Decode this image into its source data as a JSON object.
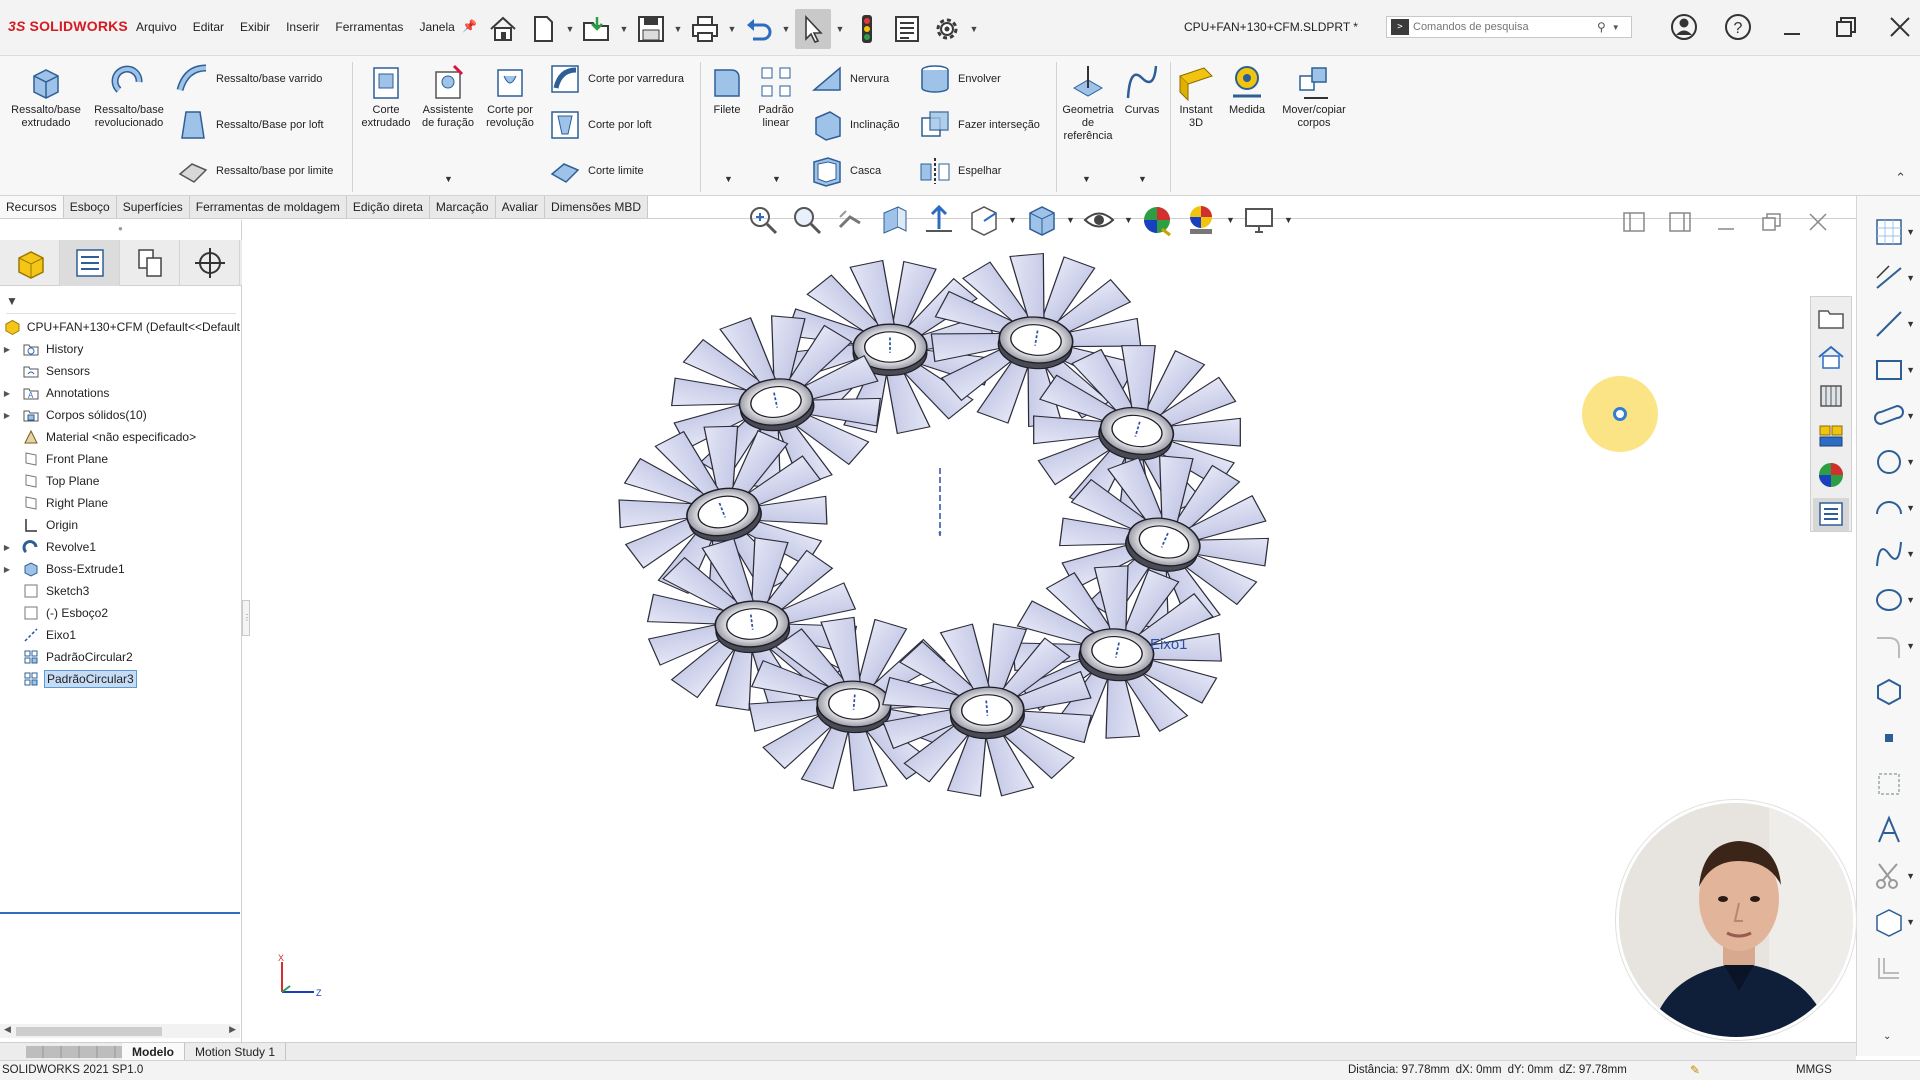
{
  "app": {
    "logo_prefix": "3S",
    "logo_text": "SOLIDWORKS",
    "document_title": "CPU+FAN+130+CFM.SLDPRT *"
  },
  "menubar": [
    "Arquivo",
    "Editar",
    "Exibir",
    "Inserir",
    "Ferramentas",
    "Janela"
  ],
  "search": {
    "placeholder": "Comandos de pesquisa"
  },
  "ribbon": {
    "extruded_boss": "Ressalto/base extrudado",
    "revolved_boss": "Ressalto/base revolucionado",
    "swept_boss": "Ressalto/base varrido",
    "loft_boss": "Ressalto/Base por loft",
    "boundary_boss": "Ressalto/base por limite",
    "extruded_cut": "Corte extrudado",
    "hole_wizard": "Assistente de furação",
    "revolved_cut": "Corte por revolução",
    "swept_cut": "Corte por varredura",
    "lofted_cut": "Corte por loft",
    "boundary_cut": "Corte limite",
    "fillet": "Filete",
    "linear_pattern": "Padrão linear",
    "rib": "Nervura",
    "draft": "Inclinação",
    "shell": "Casca",
    "wrap": "Envolver",
    "intersect": "Fazer interseção",
    "mirror": "Espelhar",
    "ref_geometry": "Geometria de referência",
    "curves": "Curvas",
    "instant3d": "Instant 3D",
    "measure": "Medida",
    "move_copy": "Mover/copiar corpos"
  },
  "tabs": [
    "Recursos",
    "Esboço",
    "Superfícies",
    "Ferramentas de moldagem",
    "Edição direta",
    "Marcação",
    "Avaliar",
    "Dimensões MBD"
  ],
  "feature_tree": {
    "root": "CPU+FAN+130+CFM  (Default<<Default",
    "items": [
      {
        "label": "History",
        "icon": "history-folder-icon",
        "expandable": true
      },
      {
        "label": "Sensors",
        "icon": "sensor-folder-icon",
        "expandable": false
      },
      {
        "label": "Annotations",
        "icon": "annotations-folder-icon",
        "expandable": true
      },
      {
        "label": "Corpos sólidos(10)",
        "icon": "solid-bodies-folder-icon",
        "expandable": true
      },
      {
        "label": "Material <não especificado>",
        "icon": "material-icon",
        "expandable": false
      },
      {
        "label": "Front Plane",
        "icon": "plane-icon",
        "expandable": false
      },
      {
        "label": "Top Plane",
        "icon": "plane-icon",
        "expandable": false
      },
      {
        "label": "Right Plane",
        "icon": "plane-icon",
        "expandable": false
      },
      {
        "label": "Origin",
        "icon": "origin-icon",
        "expandable": false
      },
      {
        "label": "Revolve1",
        "icon": "revolve-feature-icon",
        "expandable": true
      },
      {
        "label": "Boss-Extrude1",
        "icon": "extrude-feature-icon",
        "expandable": true
      },
      {
        "label": "Sketch3",
        "icon": "sketch-icon",
        "expandable": false
      },
      {
        "label": "(-) Esboço2",
        "icon": "sketch-icon",
        "expandable": false
      },
      {
        "label": "Eixo1",
        "icon": "axis-icon",
        "expandable": false
      },
      {
        "label": "PadrãoCircular2",
        "icon": "circular-pattern-icon",
        "expandable": false
      },
      {
        "label": "PadrãoCircular3",
        "icon": "circular-pattern-icon",
        "expandable": false,
        "selected": true
      }
    ]
  },
  "graphics": {
    "axis_label": "Eixo1",
    "triad_x": "X",
    "triad_z": "Z"
  },
  "bottom_tabs": [
    "Modelo",
    "Motion Study 1"
  ],
  "status": {
    "version": "SOLIDWORKS 2021 SP1.0",
    "distance": "Distância: 97.78mm",
    "dx": "dX: 0mm",
    "dy": "dY: 0mm",
    "dz": "dZ: 97.78mm",
    "units": "MMGS"
  },
  "colors": {
    "brand_red": "#d71920",
    "selection_blue": "#c6dcf5",
    "axis_blue": "#2b4fa6",
    "cursor_highlight": "#fbe27a"
  }
}
